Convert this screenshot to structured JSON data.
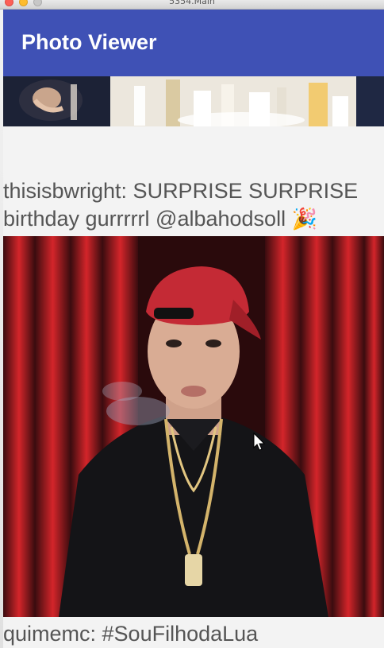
{
  "window": {
    "title": "5354.Main"
  },
  "app_bar": {
    "title": "Photo Viewer",
    "color": "#3f51b5"
  },
  "feed": {
    "posts": [
      {
        "image": "party-table-photo",
        "caption": "thisisbwright: SURPRISE SURPRISE birthday gurrrrrl @albahodsoll",
        "emoji": "🎉"
      },
      {
        "image": "man-in-red-cap-photo",
        "caption": "quimemc: #SouFilhodaLua"
      }
    ]
  }
}
